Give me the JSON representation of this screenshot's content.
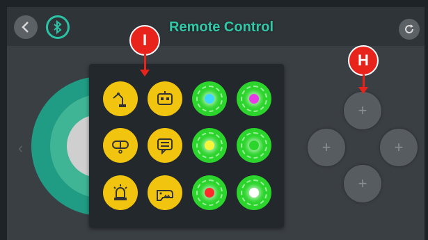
{
  "header": {
    "title": "Remote Control",
    "back_icon": "chevron-left-icon",
    "bluetooth_icon": "bluetooth-icon",
    "refresh_icon": "refresh-icon"
  },
  "colors": {
    "accent": "#2ac3a6",
    "panel_bg": "#23282c",
    "yellow_button": "#f1c40f",
    "green_button": "#2bd52b",
    "marker": "#e8231c"
  },
  "function_panel": {
    "rows": [
      [
        {
          "kind": "icon",
          "icon": "robot-arm-icon"
        },
        {
          "kind": "icon",
          "icon": "robot-face-icon"
        },
        {
          "kind": "light",
          "color": "#3dd6ff"
        },
        {
          "kind": "light",
          "color": "#e63be6"
        }
      ],
      [
        {
          "kind": "icon",
          "icon": "goggles-icon"
        },
        {
          "kind": "icon",
          "icon": "message-icon"
        },
        {
          "kind": "light",
          "color": "#f5f53a"
        },
        {
          "kind": "light",
          "color": "#2bd52b"
        }
      ],
      [
        {
          "kind": "icon",
          "icon": "alarm-siren-icon"
        },
        {
          "kind": "icon",
          "icon": "dinosaur-icon"
        },
        {
          "kind": "light",
          "color": "#ff2a2a"
        },
        {
          "kind": "light",
          "color": "#ffffff"
        }
      ]
    ]
  },
  "dpad": {
    "up_label": "+",
    "left_label": "+",
    "right_label": "+",
    "down_label": "+"
  },
  "annotations": {
    "marker_i": "I",
    "marker_h": "H"
  }
}
